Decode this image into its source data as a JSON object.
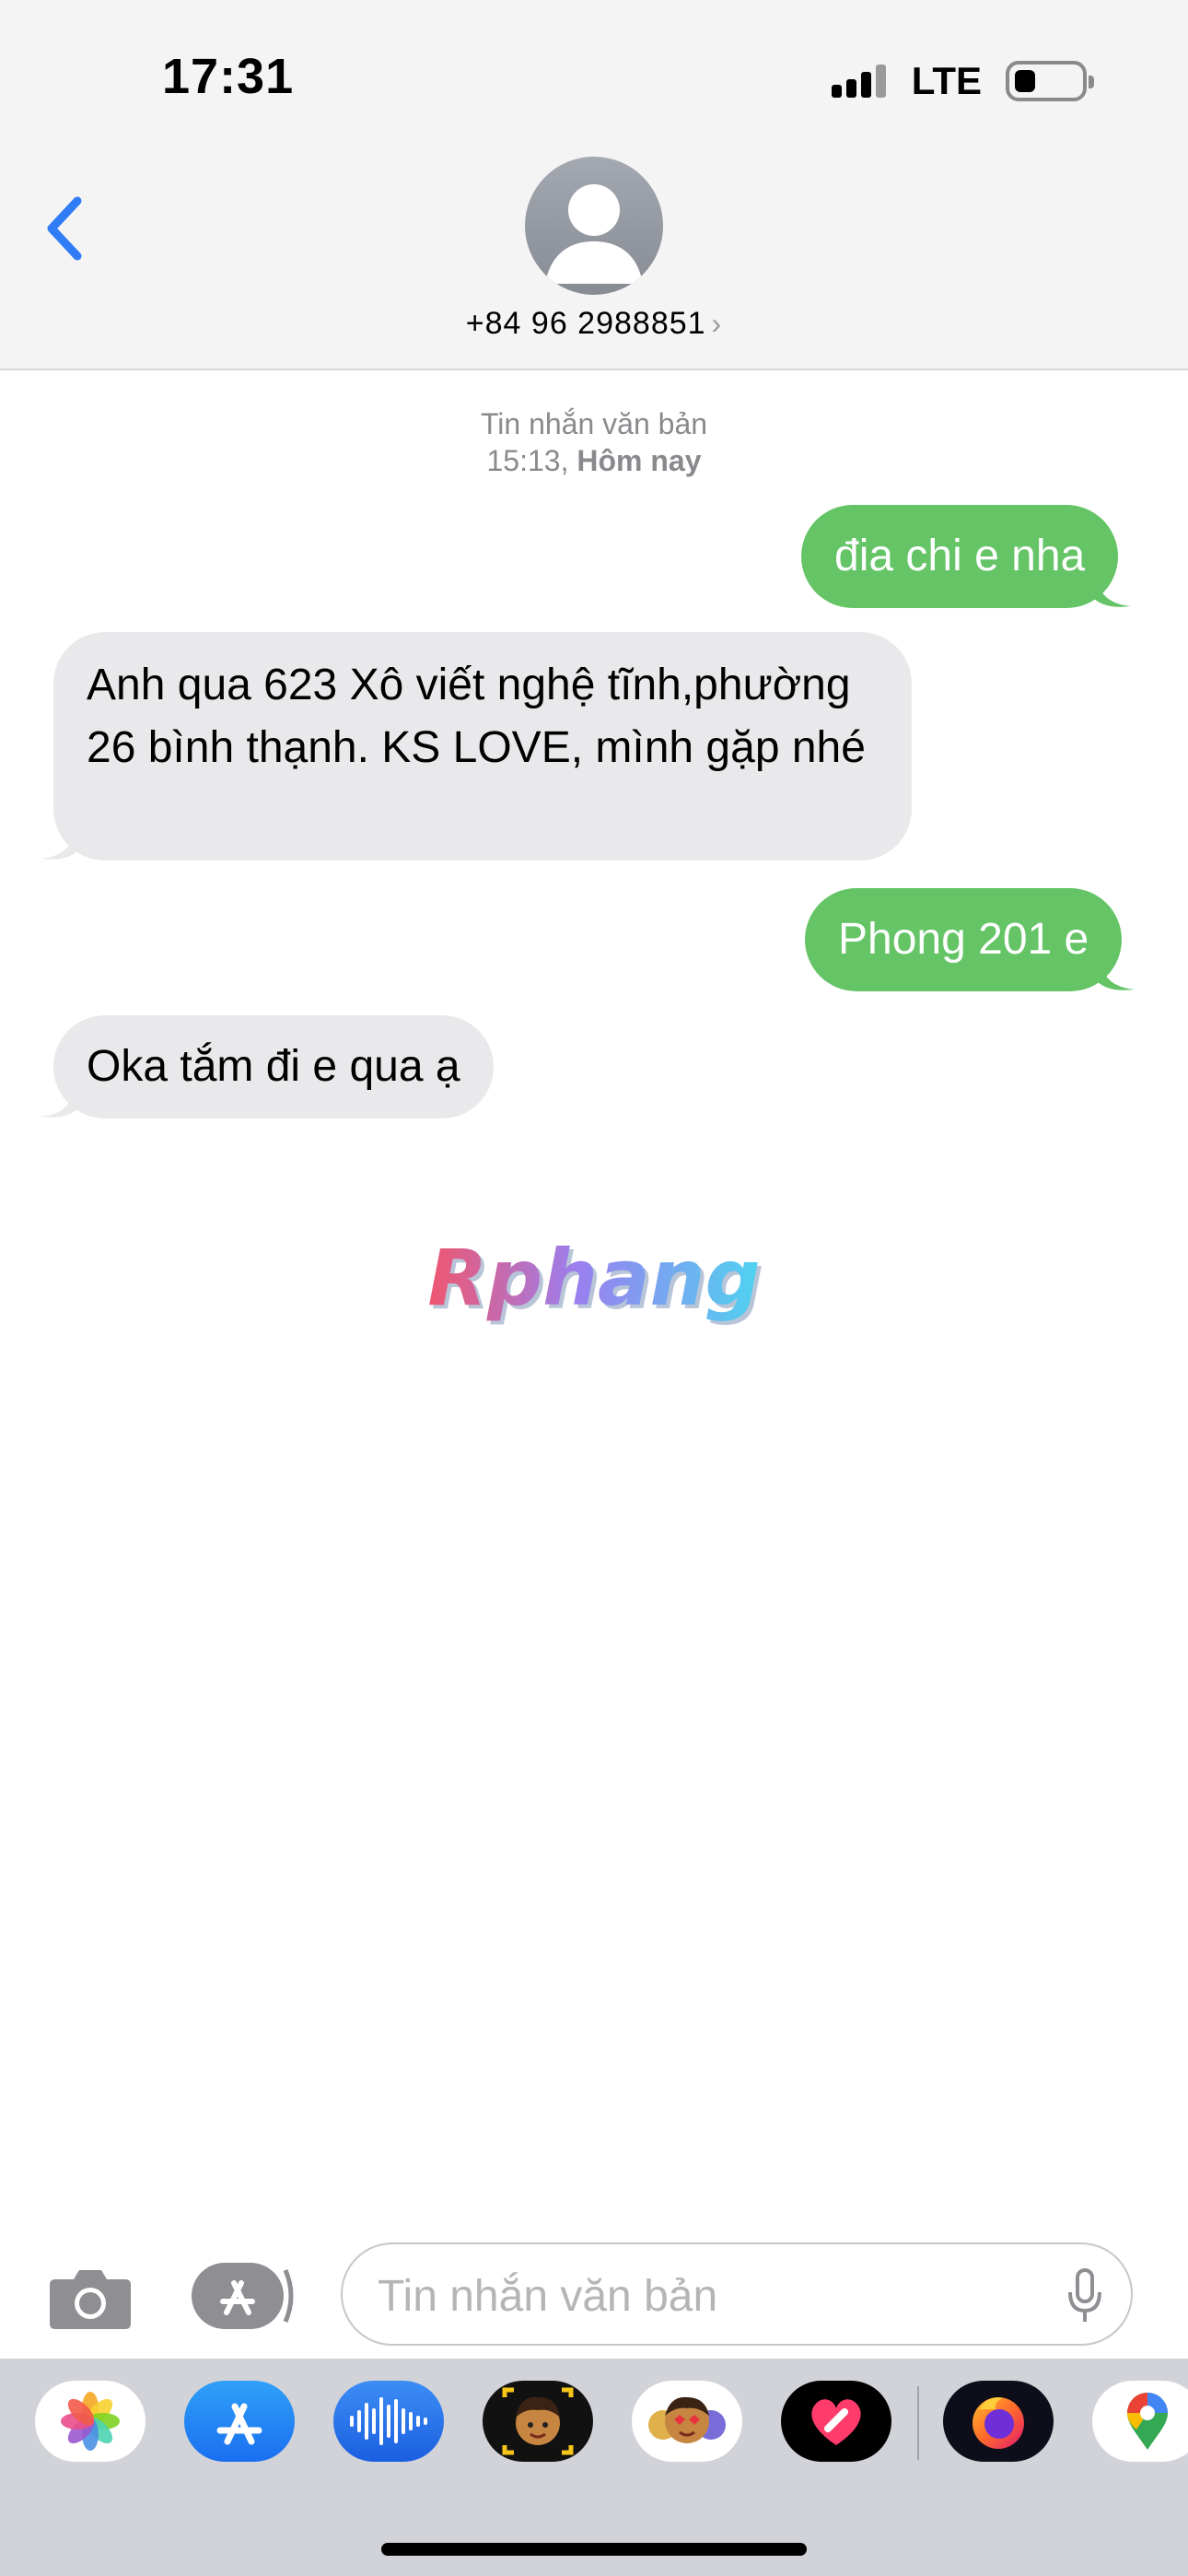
{
  "status_bar": {
    "time": "17:31",
    "network": "LTE"
  },
  "header": {
    "contact": "+84 96 2988851"
  },
  "thread": {
    "timestamp_label": "Tin nhắn văn bản",
    "timestamp_time": "15:13,",
    "timestamp_day": "Hôm nay",
    "messages": [
      {
        "direction": "sent",
        "text": "đia chi e nha"
      },
      {
        "direction": "received",
        "text": "Anh qua 623 Xô viết nghệ tĩnh,phường 26 bình thạnh. KS LOVE, mình gặp nhé"
      },
      {
        "direction": "sent",
        "text": "Phong 201 e"
      },
      {
        "direction": "received",
        "text": "Oka tắm đi e qua ạ"
      }
    ]
  },
  "watermark": {
    "text": "Rphang"
  },
  "compose": {
    "placeholder": "Tin nhắn văn bản"
  },
  "app_drawer": {
    "apps": [
      "photos-icon",
      "app-store-icon",
      "audio-message-icon",
      "memoji-icon",
      "animoji-stickers-icon",
      "digital-touch-icon",
      "firefox-icon",
      "google-maps-icon"
    ]
  },
  "colors": {
    "sent_bubble": "#64c466",
    "received_bubble": "#e9e9eb",
    "accent": "#2f7cf6"
  }
}
